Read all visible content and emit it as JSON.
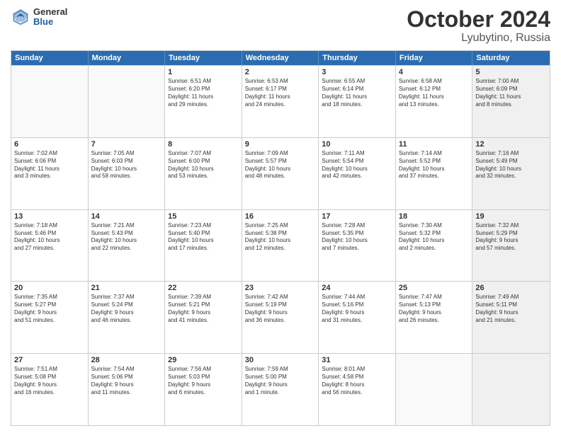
{
  "header": {
    "logo_general": "General",
    "logo_blue": "Blue",
    "month_title": "October 2024",
    "location": "Lyubytino, Russia"
  },
  "weekdays": [
    "Sunday",
    "Monday",
    "Tuesday",
    "Wednesday",
    "Thursday",
    "Friday",
    "Saturday"
  ],
  "rows": [
    [
      {
        "day": "",
        "text": "",
        "empty": true
      },
      {
        "day": "",
        "text": "",
        "empty": true
      },
      {
        "day": "1",
        "text": "Sunrise: 6:51 AM\nSunset: 6:20 PM\nDaylight: 11 hours\nand 29 minutes."
      },
      {
        "day": "2",
        "text": "Sunrise: 6:53 AM\nSunset: 6:17 PM\nDaylight: 11 hours\nand 24 minutes."
      },
      {
        "day": "3",
        "text": "Sunrise: 6:55 AM\nSunset: 6:14 PM\nDaylight: 11 hours\nand 18 minutes."
      },
      {
        "day": "4",
        "text": "Sunrise: 6:58 AM\nSunset: 6:12 PM\nDaylight: 11 hours\nand 13 minutes."
      },
      {
        "day": "5",
        "text": "Sunrise: 7:00 AM\nSunset: 6:09 PM\nDaylight: 11 hours\nand 8 minutes.",
        "shaded": true
      }
    ],
    [
      {
        "day": "6",
        "text": "Sunrise: 7:02 AM\nSunset: 6:06 PM\nDaylight: 11 hours\nand 3 minutes."
      },
      {
        "day": "7",
        "text": "Sunrise: 7:05 AM\nSunset: 6:03 PM\nDaylight: 10 hours\nand 58 minutes."
      },
      {
        "day": "8",
        "text": "Sunrise: 7:07 AM\nSunset: 6:00 PM\nDaylight: 10 hours\nand 53 minutes."
      },
      {
        "day": "9",
        "text": "Sunrise: 7:09 AM\nSunset: 5:57 PM\nDaylight: 10 hours\nand 48 minutes."
      },
      {
        "day": "10",
        "text": "Sunrise: 7:11 AM\nSunset: 5:54 PM\nDaylight: 10 hours\nand 42 minutes."
      },
      {
        "day": "11",
        "text": "Sunrise: 7:14 AM\nSunset: 5:52 PM\nDaylight: 10 hours\nand 37 minutes."
      },
      {
        "day": "12",
        "text": "Sunrise: 7:16 AM\nSunset: 5:49 PM\nDaylight: 10 hours\nand 32 minutes.",
        "shaded": true
      }
    ],
    [
      {
        "day": "13",
        "text": "Sunrise: 7:18 AM\nSunset: 5:46 PM\nDaylight: 10 hours\nand 27 minutes."
      },
      {
        "day": "14",
        "text": "Sunrise: 7:21 AM\nSunset: 5:43 PM\nDaylight: 10 hours\nand 22 minutes."
      },
      {
        "day": "15",
        "text": "Sunrise: 7:23 AM\nSunset: 5:40 PM\nDaylight: 10 hours\nand 17 minutes."
      },
      {
        "day": "16",
        "text": "Sunrise: 7:25 AM\nSunset: 5:38 PM\nDaylight: 10 hours\nand 12 minutes."
      },
      {
        "day": "17",
        "text": "Sunrise: 7:28 AM\nSunset: 5:35 PM\nDaylight: 10 hours\nand 7 minutes."
      },
      {
        "day": "18",
        "text": "Sunrise: 7:30 AM\nSunset: 5:32 PM\nDaylight: 10 hours\nand 2 minutes."
      },
      {
        "day": "19",
        "text": "Sunrise: 7:32 AM\nSunset: 5:29 PM\nDaylight: 9 hours\nand 57 minutes.",
        "shaded": true
      }
    ],
    [
      {
        "day": "20",
        "text": "Sunrise: 7:35 AM\nSunset: 5:27 PM\nDaylight: 9 hours\nand 51 minutes."
      },
      {
        "day": "21",
        "text": "Sunrise: 7:37 AM\nSunset: 5:24 PM\nDaylight: 9 hours\nand 46 minutes."
      },
      {
        "day": "22",
        "text": "Sunrise: 7:39 AM\nSunset: 5:21 PM\nDaylight: 9 hours\nand 41 minutes."
      },
      {
        "day": "23",
        "text": "Sunrise: 7:42 AM\nSunset: 5:19 PM\nDaylight: 9 hours\nand 36 minutes."
      },
      {
        "day": "24",
        "text": "Sunrise: 7:44 AM\nSunset: 5:16 PM\nDaylight: 9 hours\nand 31 minutes."
      },
      {
        "day": "25",
        "text": "Sunrise: 7:47 AM\nSunset: 5:13 PM\nDaylight: 9 hours\nand 26 minutes."
      },
      {
        "day": "26",
        "text": "Sunrise: 7:49 AM\nSunset: 5:11 PM\nDaylight: 9 hours\nand 21 minutes.",
        "shaded": true
      }
    ],
    [
      {
        "day": "27",
        "text": "Sunrise: 7:51 AM\nSunset: 5:08 PM\nDaylight: 9 hours\nand 16 minutes."
      },
      {
        "day": "28",
        "text": "Sunrise: 7:54 AM\nSunset: 5:06 PM\nDaylight: 9 hours\nand 11 minutes."
      },
      {
        "day": "29",
        "text": "Sunrise: 7:56 AM\nSunset: 5:03 PM\nDaylight: 9 hours\nand 6 minutes."
      },
      {
        "day": "30",
        "text": "Sunrise: 7:59 AM\nSunset: 5:00 PM\nDaylight: 9 hours\nand 1 minute."
      },
      {
        "day": "31",
        "text": "Sunrise: 8:01 AM\nSunset: 4:58 PM\nDaylight: 8 hours\nand 56 minutes."
      },
      {
        "day": "",
        "text": "",
        "empty": true
      },
      {
        "day": "",
        "text": "",
        "empty": true,
        "shaded": true
      }
    ]
  ]
}
